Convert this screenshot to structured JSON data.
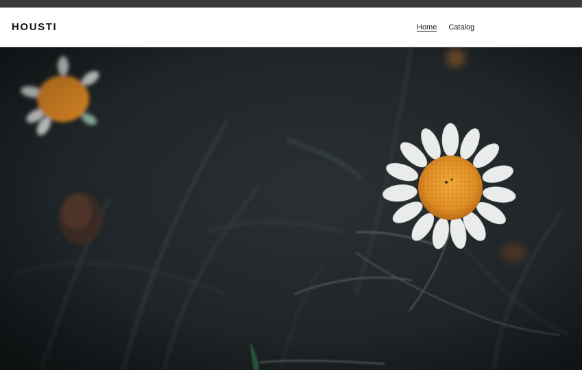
{
  "header": {
    "logo_text": "HOUSTI",
    "nav": [
      {
        "label": "Home",
        "active": true
      },
      {
        "label": "Catalog",
        "active": false
      }
    ]
  },
  "hero": {
    "image_description_icon": "daisy-photo",
    "colors": {
      "background": "#1f2528",
      "petal": "#e9ecea",
      "center": "#e0962e"
    }
  }
}
